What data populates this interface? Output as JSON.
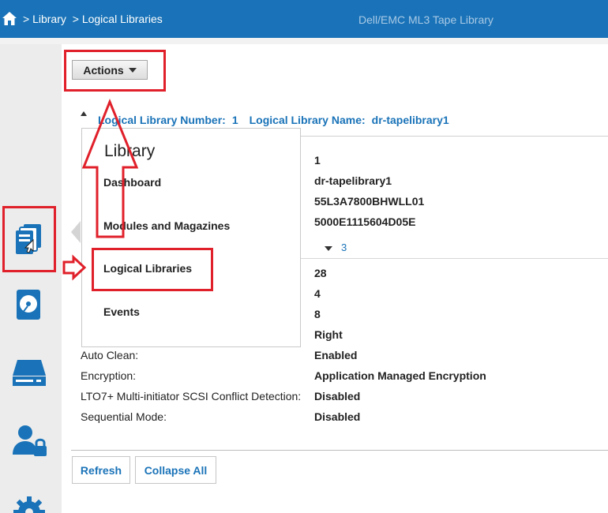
{
  "header": {
    "breadcrumbs": [
      "> Library",
      "> Logical Libraries"
    ],
    "app_title": "Dell/EMC ML3 Tape Library",
    "home_icon": "home-icon"
  },
  "toolbar": {
    "actions_label": "Actions"
  },
  "library_header": {
    "number_label": "Logical Library Number:",
    "number_value": "1",
    "name_label": "Logical Library Name:",
    "name_value": "dr-tapelibrary1"
  },
  "flyout_menu": {
    "title": "Library",
    "items": [
      "Dashboard",
      "Modules and Magazines",
      "Logical Libraries",
      "Events"
    ]
  },
  "values": {
    "number": "1",
    "name": "dr-tapelibrary1",
    "serial": "55L3A7800BHWLL01",
    "wwnn": "5000E1115604D05E",
    "drive_count": "3",
    "v28": "28",
    "v4": "4",
    "v8": "8",
    "right": "Right"
  },
  "properties": [
    {
      "label": "Auto Clean:",
      "value": "Enabled"
    },
    {
      "label": "Encryption:",
      "value": "Application Managed Encryption"
    },
    {
      "label": "LTO7+ Multi-initiator SCSI Conflict Detection:",
      "value": "Disabled"
    },
    {
      "label": "Sequential Mode:",
      "value": "Disabled"
    }
  ],
  "buttons": {
    "refresh": "Refresh",
    "collapse_all": "Collapse All"
  },
  "sidebar_icons": [
    "library-icon",
    "drive-icon",
    "server-icon",
    "user-lock-icon",
    "gear-icon"
  ],
  "colors": {
    "topbar": "#1a73b8",
    "link": "#1a73b8",
    "annotation": "#e0202a"
  }
}
